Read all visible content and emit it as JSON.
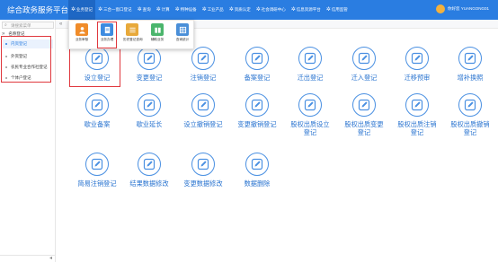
{
  "header": {
    "app_title": "综合政务服务平台",
    "nav": [
      {
        "label": "业务登记",
        "active": true
      },
      {
        "label": "三合一窗口登记",
        "active": false
      },
      {
        "label": "查询",
        "active": false
      },
      {
        "label": "计算",
        "active": false
      },
      {
        "label": "特种设备",
        "active": false
      },
      {
        "label": "工业产品",
        "active": false
      },
      {
        "label": "资质认定",
        "active": false
      },
      {
        "label": "社会调研中心",
        "active": false
      },
      {
        "label": "信息资源平台",
        "active": false
      },
      {
        "label": "信用监管",
        "active": false
      }
    ],
    "user": "你好您 YUANGONG01"
  },
  "sidebar": {
    "search_placeholder": "请搜索菜单",
    "header": "名称登记",
    "items": [
      {
        "label": "内资登记",
        "active": true
      },
      {
        "label": "外资登记",
        "active": false
      },
      {
        "label": "农民专业合作社登记",
        "active": false
      },
      {
        "label": "个体户登记",
        "active": false
      }
    ]
  },
  "dropdown": {
    "items": [
      {
        "label": "业务审核",
        "color": "#f08c2a",
        "icon": "person-icon"
      },
      {
        "label": "业务办理",
        "color": "#3d8be0",
        "icon": "document-icon"
      },
      {
        "label": "历史登记查询",
        "color": "#e8a93a",
        "icon": "list-icon"
      },
      {
        "label": "辅助业务",
        "color": "#4bb56c",
        "icon": "book-icon"
      },
      {
        "label": "查询统计",
        "color": "#4a8fd8",
        "icon": "table-icon"
      }
    ]
  },
  "colors": {
    "brand": "#2a7de1",
    "accent_text": "#2a74d0",
    "highlight": "#e0383e"
  },
  "grid": [
    [
      "设立登记"
    ],
    [
      "变更登记"
    ],
    [
      "注销登记"
    ],
    [
      "备案登记"
    ],
    [
      "迁出登记"
    ],
    [
      "迁入登记"
    ],
    [
      "迁移预审"
    ],
    [
      "增补换照"
    ],
    [
      "歇业备案"
    ],
    [
      "歇业延长"
    ],
    [
      "设立撤销登记"
    ],
    [
      "变更撤销登记"
    ],
    [
      "股权出质设立",
      "登记"
    ],
    [
      "股权出质变更",
      "登记"
    ],
    [
      "股权出质注销",
      "登记"
    ],
    [
      "股权出质撤销",
      "登记"
    ],
    [
      "简易注销登记"
    ],
    [
      "结果数据修改"
    ],
    [
      "变更数据修改"
    ],
    [
      "数据删除"
    ]
  ]
}
